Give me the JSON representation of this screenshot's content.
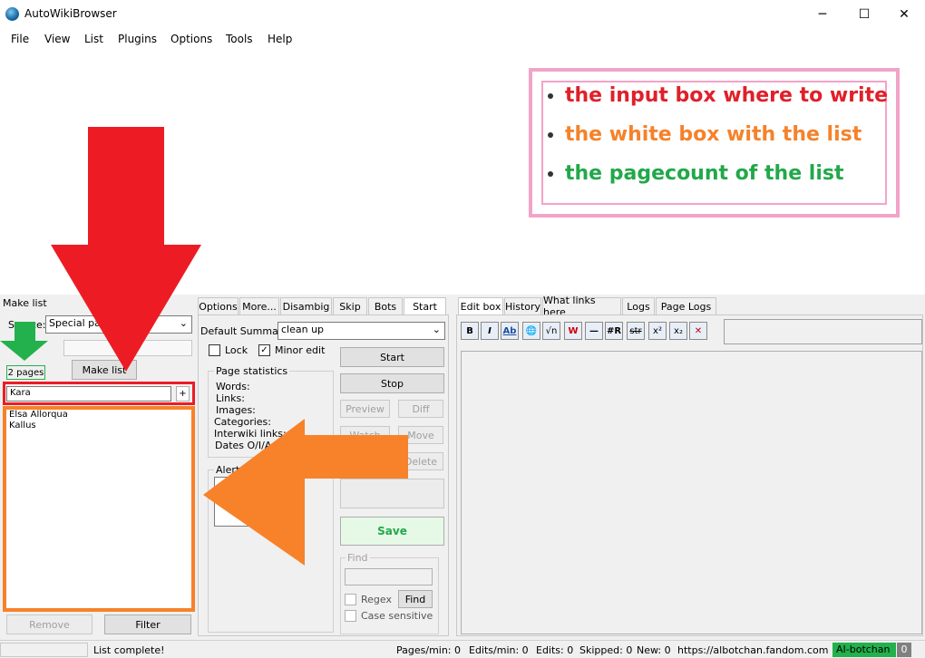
{
  "window": {
    "title": "AutoWikiBrowser",
    "minimize": "─",
    "maximize": "☐",
    "close": "✕"
  },
  "menu": [
    "File",
    "View",
    "List",
    "Plugins",
    "Options",
    "Tools",
    "Help"
  ],
  "legend": {
    "items": [
      {
        "text": "the input box where to write",
        "color": "#e0202a"
      },
      {
        "text": "the white box with the list",
        "color": "#f5822a"
      },
      {
        "text": "the pagecount of the list",
        "color": "#22a84a"
      }
    ]
  },
  "make_list": {
    "group_label": "Make list",
    "source_label": "Source:",
    "source_value": "Special page",
    "pagecount": "2 pages",
    "make_list_button": "Make list",
    "filter_input_value": "Kara",
    "add_button": "+",
    "items": [
      "Elsa Allorqua",
      "Kallus"
    ],
    "remove_button": "Remove",
    "filter_button": "Filter"
  },
  "options_tabs": [
    "Options",
    "More...",
    "Disambig",
    "Skip",
    "Bots",
    "Start"
  ],
  "start_panel": {
    "default_summary_label": "Default Summary",
    "default_summary_value": "clean up",
    "lock_label": "Lock",
    "minor_edit_label": "Minor edit",
    "minor_edit_checked": true,
    "page_stats_label": "Page statistics",
    "stats": [
      "Words:",
      "Links:",
      "Images:",
      "Categories:",
      "Interwiki links:",
      "Dates O/I/A:"
    ],
    "alerts_label": "Alerts",
    "start_button": "Start",
    "stop_button": "Stop",
    "preview_button": "Preview",
    "diff_button": "Diff",
    "watch_button": "Watch",
    "move_button": "Move",
    "delete_button": "Delete",
    "save_button": "Save",
    "find_label": "Find",
    "regex_label": "Regex",
    "find_button": "Find",
    "case_sensitive_label": "Case sensitive"
  },
  "edit_tabs": [
    "Edit box",
    "History",
    "What links here",
    "Logs",
    "Page Logs"
  ],
  "toolbar_icons": [
    "B",
    "I",
    "Ab",
    "🌐",
    "√n",
    "W",
    "—",
    "#R",
    "str",
    "x²",
    "x₂",
    "✕"
  ],
  "status": {
    "message": "List complete!",
    "pages_per_min": "Pages/min: 0",
    "edits_per_min": "Edits/min: 0",
    "edits": "Edits: 0",
    "skipped": "Skipped: 0",
    "new": "New: 0",
    "site": "https://albotchan.fandom.com",
    "user": "AI-botchan",
    "count": "0"
  },
  "colors": {
    "red": "#ed1c24",
    "orange": "#f7822a",
    "green": "#22b14c"
  }
}
